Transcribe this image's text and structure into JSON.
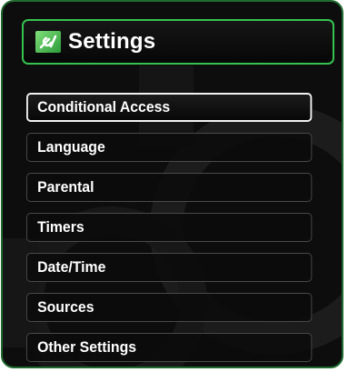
{
  "window": {
    "title": "Settings",
    "title_icon": "settings-tools-icon"
  },
  "menu": {
    "items": [
      {
        "label": "Conditional Access",
        "selected": true
      },
      {
        "label": "Language",
        "selected": false
      },
      {
        "label": "Parental",
        "selected": false
      },
      {
        "label": "Timers",
        "selected": false
      },
      {
        "label": "Date/Time",
        "selected": false
      },
      {
        "label": "Sources",
        "selected": false
      },
      {
        "label": "Other Settings",
        "selected": false
      }
    ]
  },
  "colors": {
    "accent_green": "#35c24f",
    "panel_border": "#1f6b2f",
    "selected_border": "#f2f2f2",
    "panel_bg": "#0d0d0d",
    "text": "#ffffff"
  }
}
